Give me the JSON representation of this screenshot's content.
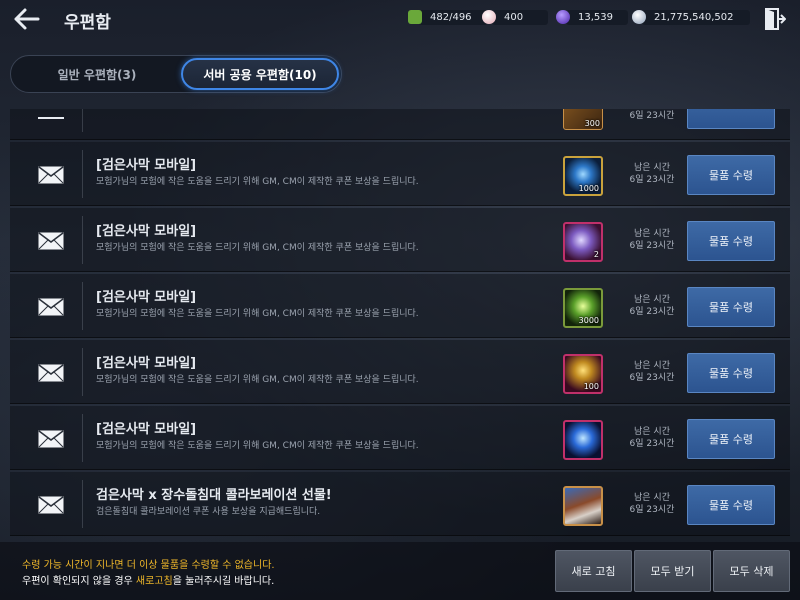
{
  "header": {
    "title": "우편함",
    "resources": [
      {
        "name": "energy",
        "value": "482/496",
        "color": "#7fbf4a"
      },
      {
        "name": "pearl",
        "value": "400",
        "color": "#e8b8c0"
      },
      {
        "name": "purple-gem",
        "value": "13,539",
        "color": "#7b4fd6"
      },
      {
        "name": "silver",
        "value": "21,775,540,502",
        "color": "#c8d4e6"
      }
    ]
  },
  "tabs": {
    "general": "일반 우편함(3)",
    "server": "서버 공용 우편함(10)"
  },
  "list": {
    "partial_qty": "300",
    "partial_remain": "6일 23시간",
    "rows": [
      {
        "title": "[검은사막 모바일]",
        "desc": "모험가님의 모험에 작은 도움을 드리기 위해 GM, CM이 제작한 쿠폰 보상을 드립니다.",
        "item_icon": "blue-orb",
        "qty": "1000",
        "remain_label": "남은 시간",
        "remain_value": "6일 23시간",
        "button": "물품 수령"
      },
      {
        "title": "[검은사막 모바일]",
        "desc": "모험가님의 모험에 작은 도움을 드리기 위해 GM, CM이 제작한 쿠폰 보상을 드립니다.",
        "item_icon": "purple-crystal",
        "qty": "2",
        "remain_label": "남은 시간",
        "remain_value": "6일 23시간",
        "button": "물품 수령"
      },
      {
        "title": "[검은사막 모바일]",
        "desc": "모험가님의 모험에 작은 도움을 드리기 위해 GM, CM이 제작한 쿠폰 보상을 드립니다.",
        "item_icon": "green-crystal",
        "qty": "3000",
        "remain_label": "남은 시간",
        "remain_value": "6일 23시간",
        "button": "물품 수령"
      },
      {
        "title": "[검은사막 모바일]",
        "desc": "모험가님의 모험에 작은 도움을 드리기 위해 GM, CM이 제작한 쿠폰 보상을 드립니다.",
        "item_icon": "gold-flower",
        "qty": "100",
        "remain_label": "남은 시간",
        "remain_value": "6일 23시간",
        "button": "물품 수령"
      },
      {
        "title": "[검은사막 모바일]",
        "desc": "모험가님의 모험에 작은 도움을 드리기 위해 GM, CM이 제작한 쿠폰 보상을 드립니다.",
        "item_icon": "blue-crystal",
        "qty": "",
        "remain_label": "남은 시간",
        "remain_value": "6일 23시간",
        "button": "물품 수령"
      },
      {
        "title": "검은사막 x 장수돌침대 콜라보레이션 선물!",
        "desc": "검은돌침대 콜라보레이션 쿠폰 사용 보상을 지급해드립니다.",
        "item_icon": "chest",
        "qty": "",
        "remain_label": "남은 시간",
        "remain_value": "6일 23시간",
        "button": "물품 수령"
      }
    ]
  },
  "footer": {
    "notice1": "수령 가능 시간이 지나면 더 이상 물품을 수령할 수 없습니다.",
    "notice2_pre": "우편이 확인되지 않을 경우 ",
    "notice2_hl": "새로고침",
    "notice2_post": "을 눌러주시길 바랍니다.",
    "refresh": "새로 고침",
    "receive_all": "모두 받기",
    "delete_all": "모두 삭제"
  }
}
